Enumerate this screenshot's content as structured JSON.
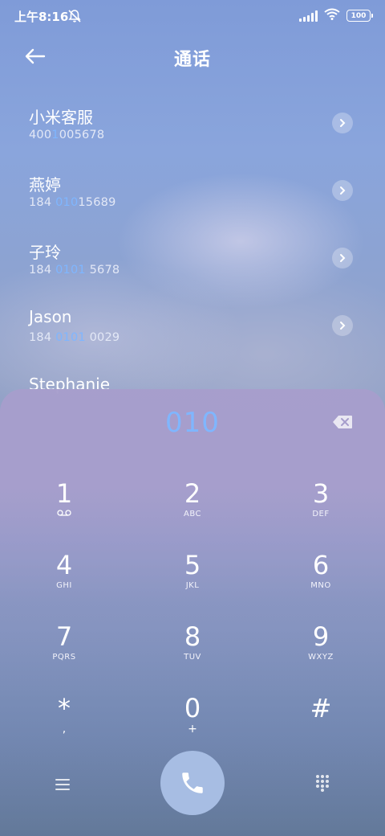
{
  "status_bar": {
    "time": "上午8:16",
    "battery": "100",
    "icons": [
      "mute-icon",
      "signal-icon",
      "wifi-icon",
      "battery-icon"
    ]
  },
  "header": {
    "title": "通话",
    "back_icon": "back-arrow-icon"
  },
  "contacts": [
    {
      "name": "小米客服",
      "number_parts": [
        "400",
        "1",
        "005678"
      ],
      "highlight_index": 1
    },
    {
      "name": "燕婷",
      "number_parts": [
        "184 ",
        "010",
        "15689"
      ],
      "highlight_index": 1
    },
    {
      "name": "子玲",
      "number_parts": [
        "184 ",
        "0101",
        " 5678"
      ],
      "highlight_index": 1
    },
    {
      "name": "Jason",
      "number_parts": [
        "184 ",
        "0101",
        " 0029"
      ],
      "highlight_index": 1
    },
    {
      "name": "Stephanie",
      "number_parts": [
        "",
        "",
        ""
      ],
      "highlight_index": 1
    }
  ],
  "dialer": {
    "input": "010",
    "keys": [
      {
        "digit": "1",
        "letters": "",
        "sub_icon": "voicemail-icon"
      },
      {
        "digit": "2",
        "letters": "ABC"
      },
      {
        "digit": "3",
        "letters": "DEF"
      },
      {
        "digit": "4",
        "letters": "GHI"
      },
      {
        "digit": "5",
        "letters": "JKL"
      },
      {
        "digit": "6",
        "letters": "MNO"
      },
      {
        "digit": "7",
        "letters": "PQRS"
      },
      {
        "digit": "8",
        "letters": "TUV"
      },
      {
        "digit": "9",
        "letters": "WXYZ"
      },
      {
        "digit": "*",
        "letters": ","
      },
      {
        "digit": "0",
        "letters": "+"
      },
      {
        "digit": "#",
        "letters": ""
      }
    ]
  },
  "colors": {
    "accent": "#7fb6ff",
    "call_button": "#a7bde3",
    "dialer_panel": "#a79ecc"
  }
}
